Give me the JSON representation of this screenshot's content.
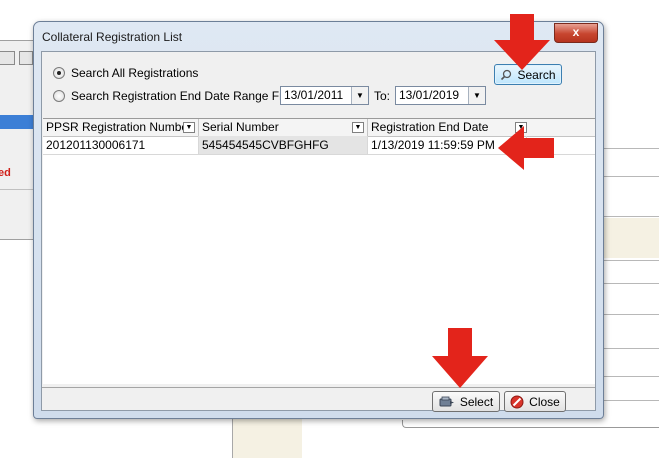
{
  "background": {
    "left_panel_text": "ed"
  },
  "dialog": {
    "title": "Collateral Registration List",
    "close_glyph": "x",
    "filters": {
      "search_all_label": "Search All Registrations",
      "search_range_label": "Search Registration End Date Range From:",
      "selected_option": "search-all",
      "from_date": "13/01/2011",
      "to_label": "To:",
      "to_date": "13/01/2019"
    },
    "search_button_label": "Search",
    "grid": {
      "columns": [
        "PPSR Registration Number",
        "Serial Number",
        "Registration End Date"
      ],
      "rows": [
        [
          "201201130006171",
          "545454545CVBFGHFG",
          "1/13/2019 11:59:59 PM"
        ]
      ]
    },
    "select_button_label": "Select",
    "close_button_label": "Close"
  },
  "colors": {
    "annotation_arrow": "#e3241b",
    "close_red": "#c7452f",
    "selection_blue": "#3c7fd6"
  },
  "icons": [
    "search-icon",
    "select-icon",
    "close-circle-icon",
    "dropdown-arrow-icon",
    "annotation-arrow-icon"
  ]
}
